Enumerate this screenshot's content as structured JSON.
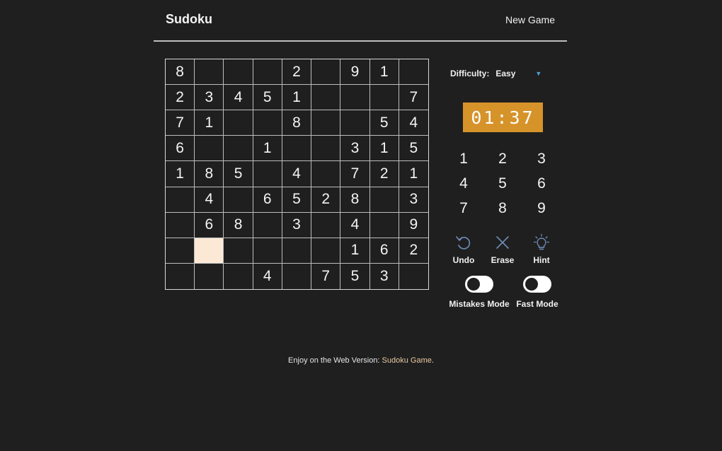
{
  "header": {
    "title": "Sudoku",
    "new_game_label": "New Game"
  },
  "board": {
    "rows": [
      [
        "8",
        "",
        "",
        "",
        "2",
        "",
        "9",
        "1",
        ""
      ],
      [
        "2",
        "3",
        "4",
        "5",
        "1",
        "",
        "",
        "",
        "7"
      ],
      [
        "7",
        "1",
        "",
        "",
        "8",
        "",
        "",
        "5",
        "4"
      ],
      [
        "6",
        "",
        "",
        "1",
        "",
        "",
        "3",
        "1",
        "5"
      ],
      [
        "1",
        "8",
        "5",
        "",
        "4",
        "",
        "7",
        "2",
        "1"
      ],
      [
        "",
        "4",
        "",
        "6",
        "5",
        "2",
        "8",
        "",
        "3"
      ],
      [
        "",
        "6",
        "8",
        "",
        "3",
        "",
        "4",
        "",
        "9"
      ],
      [
        "",
        "",
        "",
        "",
        "",
        "",
        "1",
        "6",
        "2"
      ],
      [
        "",
        "",
        "",
        "4",
        "",
        "7",
        "5",
        "3",
        ""
      ]
    ],
    "selected_cell": {
      "row": 7,
      "col": 1
    }
  },
  "difficulty": {
    "label": "Difficulty:",
    "value": "Easy"
  },
  "timer": {
    "value": "01:37"
  },
  "numpad": [
    "1",
    "2",
    "3",
    "4",
    "5",
    "6",
    "7",
    "8",
    "9"
  ],
  "tools": {
    "undo": "Undo",
    "erase": "Erase",
    "hint": "Hint"
  },
  "toggles": {
    "mistakes_mode": {
      "label": "Mistakes Mode",
      "on": false
    },
    "fast_mode": {
      "label": "Fast Mode",
      "on": false
    }
  },
  "footer": {
    "text": "Enjoy on the Web Version: ",
    "link": "Sudoku Game",
    "suffix": "."
  },
  "colors": {
    "background": "#1f1f1f",
    "timer": "#d6932a",
    "selected_cell": "#fbe9d6",
    "link": "#e8c9a0",
    "dropdown_arrow": "#4aa3df"
  }
}
